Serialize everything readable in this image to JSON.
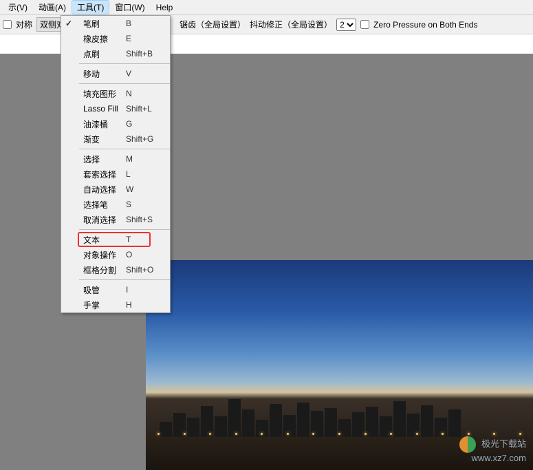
{
  "menubar": {
    "items": [
      {
        "label": "示(V)"
      },
      {
        "label": "动画(A)"
      },
      {
        "label": "工具(T)"
      },
      {
        "label": "窗口(W)"
      },
      {
        "label": "Help"
      }
    ]
  },
  "toolbar": {
    "symmetry_label": "对称",
    "symmetry_btn": "双侧对",
    "antialias_label": "锯齿（全局设置）",
    "jitter_label": "抖动修正（全局设置）",
    "jitter_value": "2",
    "zero_pressure_label": "Zero Pressure on Both Ends"
  },
  "dropdown": {
    "groups": [
      [
        {
          "label": "笔刷",
          "shortcut": "B",
          "checked": true
        },
        {
          "label": "橡皮擦",
          "shortcut": "E"
        },
        {
          "label": "点刷",
          "shortcut": "Shift+B"
        }
      ],
      [
        {
          "label": "移动",
          "shortcut": "V"
        }
      ],
      [
        {
          "label": "填充图形",
          "shortcut": "N"
        },
        {
          "label": "Lasso Fill",
          "shortcut": "Shift+L"
        },
        {
          "label": "油漆桶",
          "shortcut": "G"
        },
        {
          "label": "渐变",
          "shortcut": "Shift+G"
        }
      ],
      [
        {
          "label": "选择",
          "shortcut": "M"
        },
        {
          "label": "套索选择",
          "shortcut": "L"
        },
        {
          "label": "自动选择",
          "shortcut": "W"
        },
        {
          "label": "选择笔",
          "shortcut": "S"
        },
        {
          "label": "取消选择",
          "shortcut": "Shift+S"
        }
      ],
      [
        {
          "label": "文本",
          "shortcut": "T",
          "highlight": true
        },
        {
          "label": "对象操作",
          "shortcut": "O"
        },
        {
          "label": "框格分割",
          "shortcut": "Shift+O"
        }
      ],
      [
        {
          "label": "吸管",
          "shortcut": "I"
        },
        {
          "label": "手掌",
          "shortcut": "H"
        }
      ]
    ]
  },
  "watermark": {
    "line1": "极光下载站",
    "line2": "www.xz7.com"
  }
}
